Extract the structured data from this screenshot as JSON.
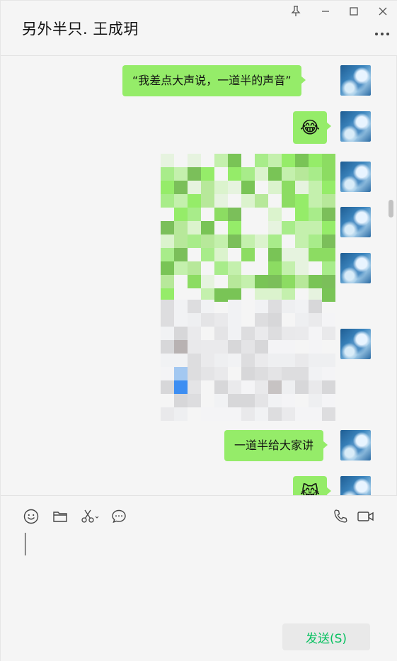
{
  "window": {
    "title": "另外半只. 王成玥",
    "pin_icon": "pin-icon",
    "minimize_icon": "minimize-icon",
    "maximize_icon": "maximize-icon",
    "close_icon": "close-icon",
    "more_icon": "more-icon"
  },
  "messages": [
    {
      "type": "text",
      "text": "“我差点大声说，一道半的声音”"
    },
    {
      "type": "emoji",
      "text": "😂"
    },
    {
      "type": "image",
      "note": "pixelated"
    },
    {
      "type": "image",
      "note": "pixelated"
    },
    {
      "type": "text",
      "text": "一道半给大家讲"
    },
    {
      "type": "emoji",
      "text": "😹"
    }
  ],
  "toolbar": {
    "icons": [
      "emoji-icon",
      "folder-icon",
      "scissors-icon",
      "chat-icon",
      "phone-icon",
      "video-icon"
    ]
  },
  "composer": {
    "value": "",
    "send_label": "发送(S)"
  },
  "colors": {
    "bubble": "#95ec69",
    "background": "#f5f5f5",
    "send_text": "#07c160"
  }
}
